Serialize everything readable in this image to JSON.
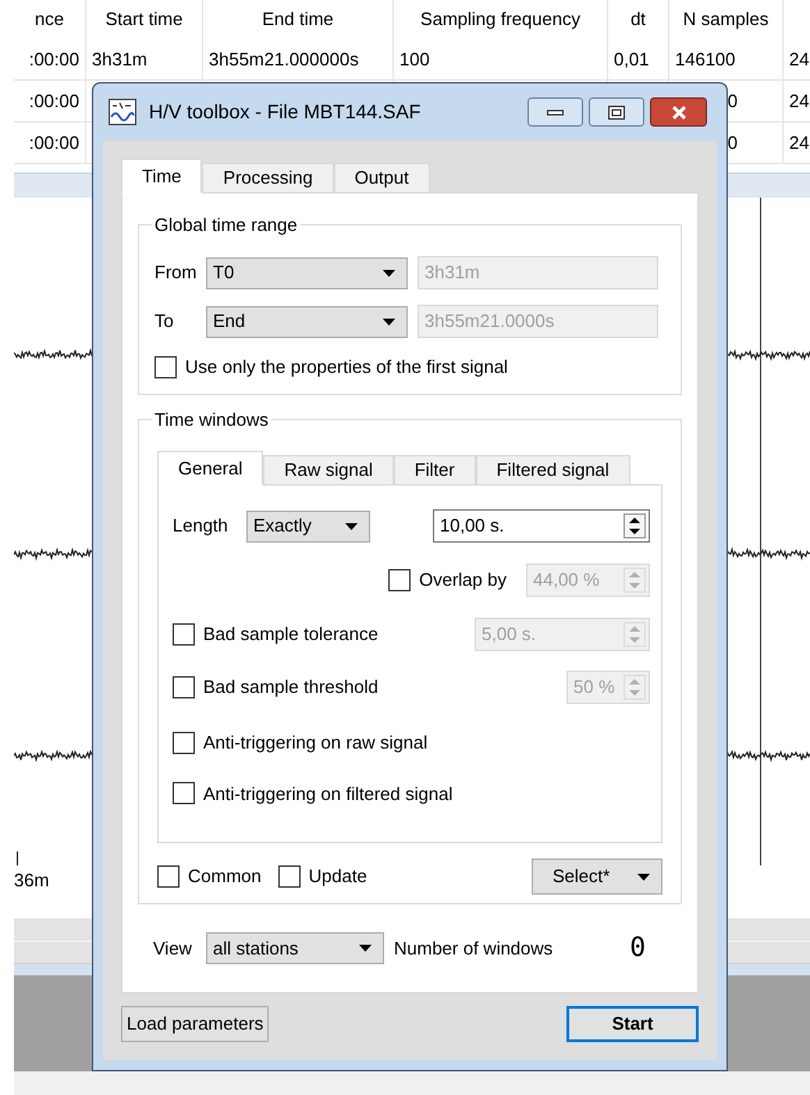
{
  "background_table": {
    "columns": [
      "nce",
      "Start time",
      "End time",
      "Sampling frequency",
      "dt",
      "N samples"
    ],
    "rows": [
      {
        "column_1": ":00:00",
        "start_time": "3h31m",
        "end_time": "3h55m21.000000s",
        "sampling_frequency": "100",
        "dt": "0,01",
        "n_samples": "146100",
        "column_7": "24"
      },
      {
        "column_1": ":00:00",
        "n_samples_fragment": "0",
        "column_7": "24"
      },
      {
        "column_1": ":00:00",
        "n_samples_fragment": "0",
        "column_7": "24"
      }
    ]
  },
  "background_plot": {
    "axis_label": "36m"
  },
  "dialog": {
    "title": "H/V toolbox - File MBT144.SAF",
    "tabs": [
      {
        "label": "Time",
        "selected": true
      },
      {
        "label": "Processing",
        "selected": false
      },
      {
        "label": "Output",
        "selected": false
      }
    ],
    "global_time_range": {
      "title": "Global time range",
      "from": {
        "label": "From",
        "mode": "T0",
        "value": "3h31m",
        "disabled": true
      },
      "to": {
        "label": "To",
        "mode": "End",
        "value": "3h55m21.0000s",
        "disabled": true
      },
      "first_signal_only": {
        "label": "Use only the properties of the first signal",
        "checked": false
      }
    },
    "time_windows": {
      "title": "Time windows",
      "tabs": [
        {
          "label": "General",
          "selected": true
        },
        {
          "label": "Raw signal",
          "selected": false
        },
        {
          "label": "Filter",
          "selected": false
        },
        {
          "label": "Filtered signal",
          "selected": false
        }
      ],
      "length": {
        "label": "Length",
        "mode": "Exactly",
        "value": "10,00 s.",
        "disabled": false
      },
      "overlap": {
        "label": "Overlap by",
        "checked": false,
        "value": "44,00 %",
        "disabled": true
      },
      "bad_sample_tolerance": {
        "label": "Bad sample tolerance",
        "checked": false,
        "value": "5,00 s.",
        "disabled": true
      },
      "bad_sample_threshold": {
        "label": "Bad sample threshold",
        "checked": false,
        "value": "50 %",
        "disabled": true
      },
      "anti_triggering_raw": {
        "label": "Anti-triggering on raw signal",
        "checked": false
      },
      "anti_triggering_filtered": {
        "label": "Anti-triggering on filtered signal",
        "checked": false
      },
      "common": {
        "label": "Common",
        "checked": false
      },
      "update": {
        "label": "Update",
        "checked": false
      },
      "select_button": "Select*"
    },
    "view": {
      "label": "View",
      "value": "all stations"
    },
    "number_of_windows": {
      "label": "Number of windows",
      "value": "0"
    },
    "buttons": [
      {
        "label": "Load parameters",
        "default": false
      },
      {
        "label": "Start",
        "default": true
      }
    ]
  }
}
